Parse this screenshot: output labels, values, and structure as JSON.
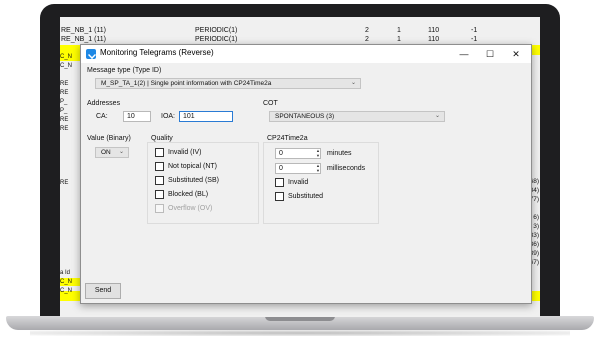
{
  "background_app": {
    "rows": [
      {
        "c1": "RE_NB_1 (11)",
        "c2": "PERIODIC(1)",
        "c3": "2",
        "c4": "1",
        "c5": "110",
        "c6": "-1"
      },
      {
        "c1": "RE_NB_1 (11)",
        "c2": "PERIODIC(1)",
        "c3": "2",
        "c4": "1",
        "c5": "110",
        "c6": "-1"
      }
    ],
    "left_fragments": [
      "C_N",
      "C_N",
      "RE",
      "RE",
      "P_",
      "P_",
      "RE",
      "RE",
      "RE",
      "a Id",
      "C_N",
      "C_N"
    ],
    "right_fragments": [
      "(768)",
      "384)",
      "77)",
      "6)",
      "3)",
      "83)",
      "36)",
      "39)",
      "67)"
    ]
  },
  "dialog": {
    "title": "Monitoring Telegrams (Reverse)",
    "controls": {
      "minimize": "—",
      "maximize": "☐",
      "close": "✕"
    },
    "message_type": {
      "label": "Message type (Type ID)",
      "value": "M_SP_TA_1(2) | Single point information with CP24Time2a"
    },
    "addresses": {
      "label": "Addresses",
      "ca_label": "CA:",
      "ca_value": "10",
      "ioa_label": "IOA:",
      "ioa_value": "101"
    },
    "cot": {
      "label": "COT",
      "value": "SPONTANEOUS (3)"
    },
    "value_binary": {
      "label": "Value (Binary)",
      "value": "ON"
    },
    "quality": {
      "label": "Quality",
      "items": [
        {
          "label": "Invalid (IV)",
          "checked": false,
          "enabled": true
        },
        {
          "label": "Not topical (NT)",
          "checked": false,
          "enabled": true
        },
        {
          "label": "Substituted (SB)",
          "checked": false,
          "enabled": true
        },
        {
          "label": "Blocked (BL)",
          "checked": false,
          "enabled": true
        },
        {
          "label": "Overflow (OV)",
          "checked": false,
          "enabled": false
        }
      ]
    },
    "cp24time2a": {
      "label": "CP24Time2a",
      "minutes_value": "0",
      "minutes_label": "minutes",
      "ms_value": "0",
      "ms_label": "milliseconds",
      "invalid_label": "Invalid",
      "substituted_label": "Substituted"
    },
    "send_label": "Send"
  },
  "colors": {
    "highlight": "#ffff00",
    "focus": "#2a7bd4",
    "icon": "#1e88e5"
  }
}
